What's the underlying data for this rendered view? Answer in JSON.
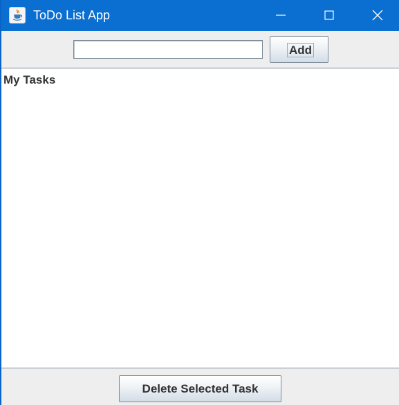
{
  "window": {
    "title": "ToDo List App",
    "app_icon": "java-cup-icon",
    "controls": [
      "minimize-icon",
      "maximize-icon",
      "close-icon"
    ]
  },
  "toolbar": {
    "task_input_value": "",
    "task_input_placeholder": "",
    "add_label": "Add"
  },
  "list": {
    "title": "My Tasks",
    "items": []
  },
  "footer": {
    "delete_label": "Delete Selected Task"
  },
  "colors": {
    "titlebar": "#0a6fd1",
    "panel": "#eeeeee",
    "text": "#333333"
  }
}
